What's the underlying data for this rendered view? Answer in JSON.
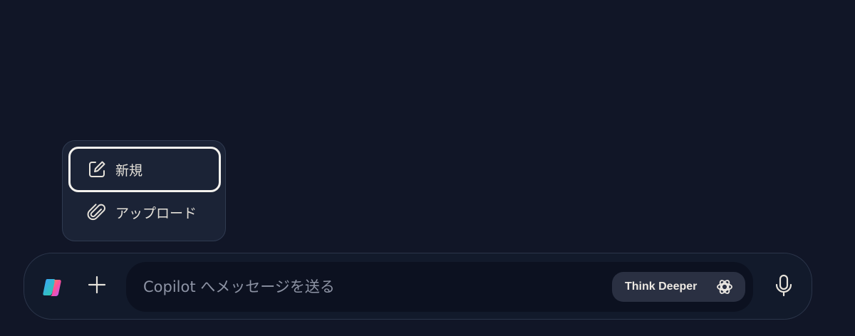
{
  "menu": {
    "items": [
      {
        "label": "新規",
        "icon": "new-chat-icon"
      },
      {
        "label": "アップロード",
        "icon": "paperclip-icon"
      }
    ]
  },
  "composer": {
    "placeholder": "Copilot へメッセージを送る",
    "value": "",
    "think_button_label": "Think Deeper",
    "icons": {
      "logo": "copilot-logo-icon",
      "add": "plus-icon",
      "think": "think-deeper-icon",
      "mic": "microphone-icon"
    }
  },
  "colors": {
    "background": "#111627",
    "menu_background": "#1b2336",
    "composer_background": "#121a2b",
    "input_background": "#0c1120",
    "think_button_background": "#2a3042",
    "text": "#e6e2da",
    "placeholder": "#8d93a4"
  }
}
